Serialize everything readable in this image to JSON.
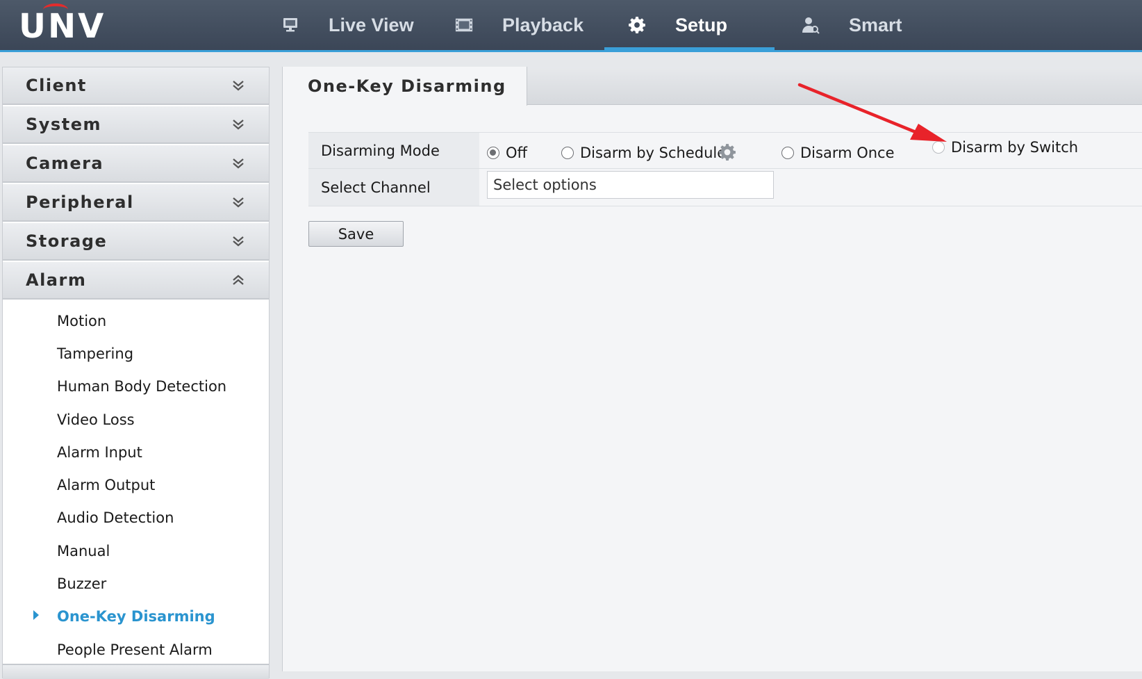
{
  "brand": {
    "logo_text": "UNV"
  },
  "nav": [
    {
      "id": "live-view",
      "label": "Live View",
      "icon": "monitor-icon",
      "active": false
    },
    {
      "id": "playback",
      "label": "Playback",
      "icon": "film-icon",
      "active": false
    },
    {
      "id": "setup",
      "label": "Setup",
      "icon": "gear-icon",
      "active": true
    },
    {
      "id": "smart",
      "label": "Smart",
      "icon": "person-search-icon",
      "active": false
    }
  ],
  "sidebar": {
    "sections": [
      {
        "label": "Client",
        "expanded": false
      },
      {
        "label": "System",
        "expanded": false
      },
      {
        "label": "Camera",
        "expanded": false
      },
      {
        "label": "Peripheral",
        "expanded": false
      },
      {
        "label": "Storage",
        "expanded": false
      },
      {
        "label": "Alarm",
        "expanded": true
      }
    ],
    "alarm_items": [
      "Motion",
      "Tampering",
      "Human Body Detection",
      "Video Loss",
      "Alarm Input",
      "Alarm Output",
      "Audio Detection",
      "Manual",
      "Buzzer",
      "One-Key Disarming",
      "People Present Alarm"
    ],
    "active_item": "One-Key Disarming"
  },
  "main": {
    "tab_title": "One-Key Disarming",
    "disarming_mode": {
      "label": "Disarming Mode",
      "options": [
        "Off",
        "Disarm by Schedule",
        "Disarm Once",
        "Disarm by Switch"
      ],
      "selected": "Off"
    },
    "select_channel": {
      "label": "Select Channel",
      "placeholder": "Select options"
    },
    "save_label": "Save"
  },
  "colors": {
    "accent": "#3a9fd8",
    "active_text": "#2a94cf",
    "annotation_arrow": "#e8232a",
    "topbar": "#3f4a5b"
  }
}
